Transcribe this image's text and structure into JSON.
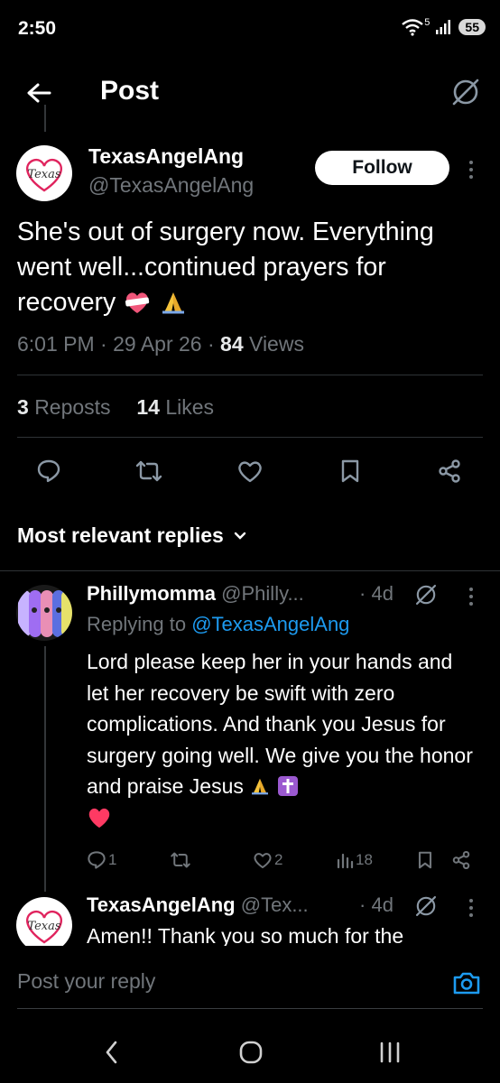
{
  "status": {
    "time": "2:50",
    "signal_badge": "5",
    "battery": "55"
  },
  "header": {
    "title": "Post",
    "back_icon": "arrow-left-icon",
    "grok_icon": "grok-icon"
  },
  "post": {
    "author_name": "TexasAngelAng",
    "author_handle": "@TexasAngelAng",
    "avatar_text": "Texas",
    "follow_label": "Follow",
    "text": "She's out of surgery now. Everything went well...continued prayers for recovery",
    "emojis": [
      "mending-heart",
      "folded-hands"
    ],
    "time": "6:01 PM",
    "date": "29 Apr 26",
    "views_count": "84",
    "views_label": "Views",
    "reposts_count": "3",
    "reposts_label": "Reposts",
    "likes_count": "14",
    "likes_label": "Likes"
  },
  "actions": [
    "reply-icon",
    "repost-icon",
    "like-icon",
    "bookmark-icon",
    "share-icon"
  ],
  "sort": {
    "label": "Most relevant replies"
  },
  "replies": [
    {
      "name": "Phillymomma",
      "handle": "@Philly...",
      "time": "4d",
      "replying_prefix": "Replying to",
      "replying_to": "@TexasAngelAng",
      "text": "Lord please keep her in your hands and let her recovery be swift with zero complications. And thank you Jesus for surgery going well. We give you the honor and praise Jesus",
      "reply_count": "1",
      "like_count": "2",
      "view_count": "18"
    },
    {
      "name": "TexasAngelAng",
      "handle": "@Tex...",
      "time": "4d",
      "avatar_text": "Texas",
      "text": "Amen!! Thank you so much for the"
    }
  ],
  "compose": {
    "placeholder": "Post your reply"
  },
  "colors": {
    "background": "#000000",
    "text": "#e7e9ea",
    "muted": "#71767b",
    "link": "#1d9bf0",
    "divider": "#2f3336"
  }
}
